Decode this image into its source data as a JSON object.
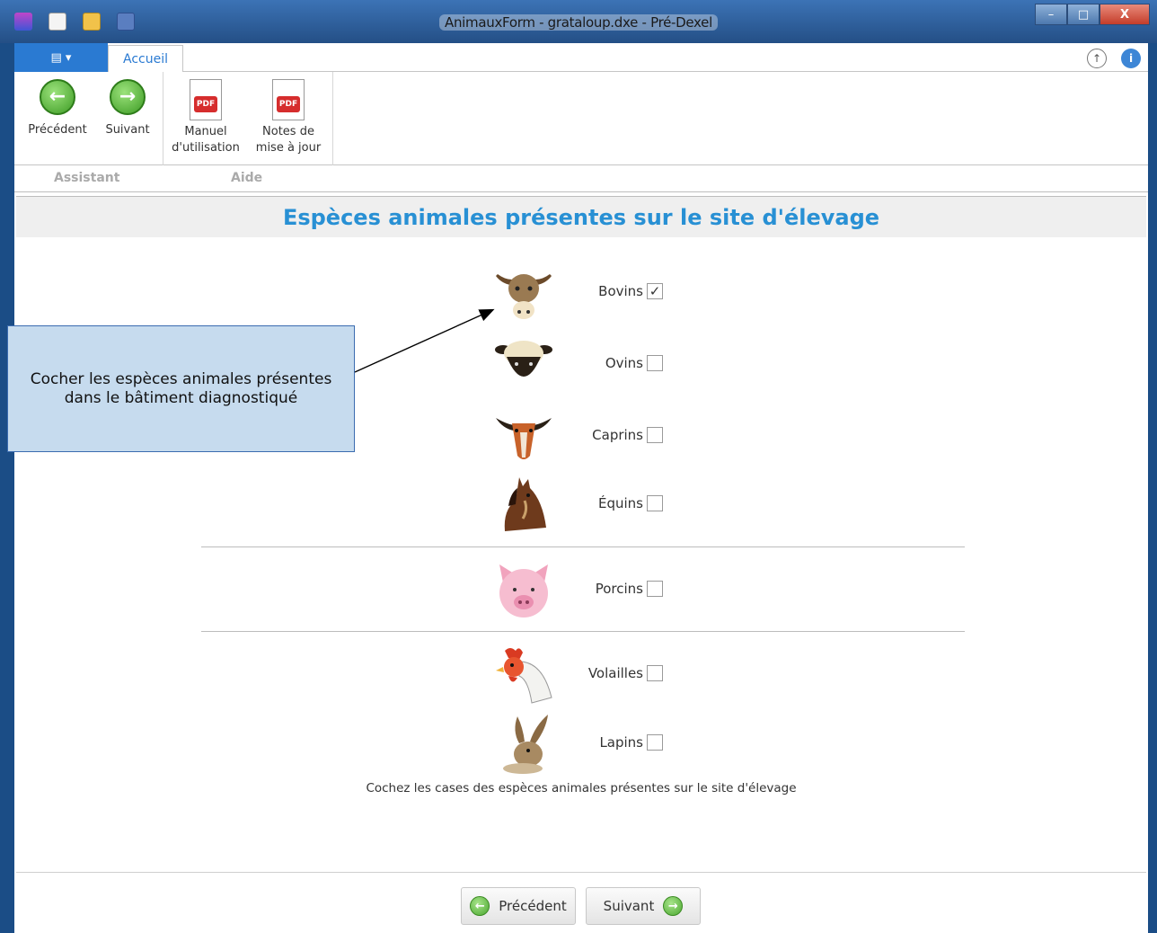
{
  "window": {
    "title": "AnimauxForm - grataloup.dxe - Pré-Dexel",
    "minimize_glyph": "–",
    "maximize_glyph": "□",
    "close_glyph": "X",
    "quick_access_icons": [
      "app-icon",
      "new-icon",
      "open-folder-icon",
      "save-icon"
    ]
  },
  "ribbon": {
    "app_menu_glyph": "▤ ▾",
    "tab_accueil": "Accueil",
    "collapse_glyph": "↑",
    "info_glyph": "i",
    "buttons": {
      "precedent": "Précédent",
      "suivant": "Suivant",
      "manuel_line1": "Manuel",
      "manuel_line2": "d'utilisation",
      "notes_line1": "Notes de",
      "notes_line2": "mise à jour",
      "pdf_badge": "PDF"
    },
    "groups": {
      "assistant": "Assistant",
      "aide": "Aide"
    }
  },
  "page": {
    "title": "Espèces animales présentes sur le site d'élevage",
    "hint": "Cochez les cases des espèces animales présentes sur le site d'élevage",
    "species": [
      {
        "label": "Bovins",
        "checked": true,
        "icon": "cow-icon"
      },
      {
        "label": "Ovins",
        "checked": false,
        "icon": "sheep-icon"
      },
      {
        "label": "Caprins",
        "checked": false,
        "icon": "goat-icon"
      },
      {
        "label": "Équins",
        "checked": false,
        "icon": "horse-icon"
      },
      {
        "label": "Porcins",
        "checked": false,
        "icon": "pig-icon"
      },
      {
        "label": "Volailles",
        "checked": false,
        "icon": "chicken-icon"
      },
      {
        "label": "Lapins",
        "checked": false,
        "icon": "rabbit-icon"
      }
    ],
    "checkmark": "✓",
    "nav": {
      "precedent": "Précédent",
      "suivant": "Suivant"
    }
  },
  "callout": {
    "line1": "Cocher les espèces animales présentes",
    "line2": "dans le bâtiment diagnostiqué"
  },
  "colors": {
    "accent_blue": "#2a7ad2",
    "title_blue": "#2890d4",
    "callout_fill": "#c6dbee",
    "green_arrow": "#3d9b24"
  }
}
